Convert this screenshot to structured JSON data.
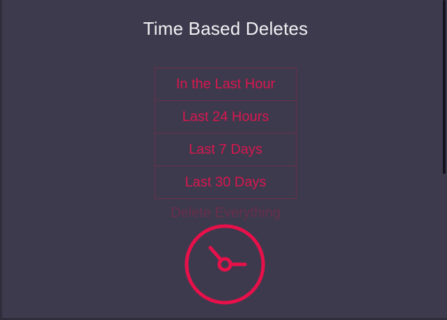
{
  "header": {
    "title": "Time Based Deletes"
  },
  "menu": {
    "items": [
      {
        "label": "In the Last Hour"
      },
      {
        "label": "Last 24 Hours"
      },
      {
        "label": "Last 7 Days"
      },
      {
        "label": "Last 30 Days"
      },
      {
        "label": "Delete Everything"
      }
    ]
  },
  "clock_button": {
    "icon": "clock-icon"
  },
  "colors": {
    "background": "#3d3a4d",
    "accent": "#e8104a",
    "menu_border": "#6b2f4c",
    "title_text": "#f1f1f4"
  }
}
